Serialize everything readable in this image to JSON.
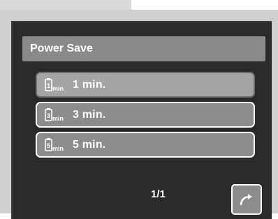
{
  "menu": {
    "title": "Power Save",
    "items": [
      {
        "icon": "power-save-1min-icon",
        "label": "1 min.",
        "selected": true
      },
      {
        "icon": "power-save-3min-icon",
        "label": "3 min.",
        "selected": false
      },
      {
        "icon": "power-save-5min-icon",
        "label": "5 min.",
        "selected": false
      }
    ]
  },
  "footer": {
    "page": "1/1",
    "next_icon": "redo-arrow-icon"
  }
}
